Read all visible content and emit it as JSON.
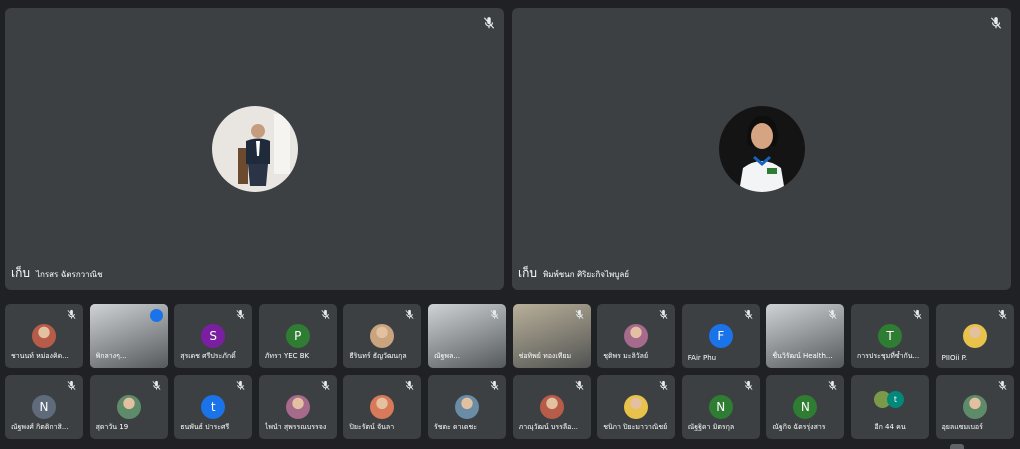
{
  "main_tiles": [
    {
      "name": "ไกรสร ฉัตรกวาณิช",
      "hide_label": "เก็บ",
      "muted": true
    },
    {
      "name": "พิมพ์ชนก ศิริยะกิจไพบูลย์",
      "hide_label": "เก็บ",
      "muted": true
    }
  ],
  "row1": [
    {
      "name": "ชานนท์ หม่องคิด...",
      "avatar": "photo",
      "muted": true
    },
    {
      "name": "พิกลางๆ...",
      "avatar": "video",
      "speaking": true
    },
    {
      "name": "สุรเดช ศรีประภักดิ์",
      "avatar": "letter",
      "letter": "S",
      "color": "#7b1fa2",
      "muted": true
    },
    {
      "name": "ภัทรา YEC BK",
      "avatar": "letter",
      "letter": "P",
      "color": "#2e7d32",
      "muted": true
    },
    {
      "name": "ธีรินทร์ ธัญวัฒนกุล",
      "avatar": "photo",
      "muted": true
    },
    {
      "name": "ณัฐพล...",
      "avatar": "video",
      "muted": true
    },
    {
      "name": "ช่อทิพย์ ทองเทียม",
      "avatar": "video",
      "muted": true
    },
    {
      "name": "ชุติพร มะลิวัลย์",
      "avatar": "photo",
      "muted": true
    },
    {
      "name": "FAir Phu",
      "avatar": "letter",
      "letter": "F",
      "color": "#1a73e8",
      "muted": true
    },
    {
      "name": "ชื่นวิรัฒน์ Health...",
      "avatar": "video",
      "muted": true
    },
    {
      "name": "การประชุมที่ซ้ำกัน...",
      "avatar": "letter",
      "letter": "T",
      "color": "#2e7d32",
      "muted": true
    },
    {
      "name": "PIIOii P.",
      "avatar": "photo",
      "muted": true
    }
  ],
  "row2": [
    {
      "name": "ณัฐพงศ์ กิตติกาสิ...",
      "avatar": "letter",
      "letter": "N",
      "color": "#5f6b7a",
      "muted": true
    },
    {
      "name": "สุดาวัน 19",
      "avatar": "photo",
      "muted": true
    },
    {
      "name": "ธนพันธ์ ปาระศรี",
      "avatar": "letter",
      "letter": "t",
      "color": "#1a73e8",
      "muted": true
    },
    {
      "name": "ไพนำ สุพรรณบรรจง",
      "avatar": "photo",
      "muted": true
    },
    {
      "name": "ปิยะรัตน์ จันลา",
      "avatar": "photo",
      "muted": true
    },
    {
      "name": "รัชตะ ดาเดชะ",
      "avatar": "photo",
      "muted": true
    },
    {
      "name": "ภาณุวัฒน์ บรรลือ...",
      "avatar": "photo",
      "muted": true
    },
    {
      "name": "ชนิกา ปิยะมาวาณิชย์",
      "avatar": "photo",
      "muted": true
    },
    {
      "name": "ณัฐฐิดา มิตรกุล",
      "avatar": "letter",
      "letter": "N",
      "color": "#2e7d32",
      "muted": true
    },
    {
      "name": "ณัฐกิจ ฉัตรรุ่งสาร",
      "avatar": "letter",
      "letter": "N",
      "color": "#2e7d32",
      "muted": true
    },
    {
      "name": "อีก 44 คน",
      "avatar": "more",
      "letter": "t",
      "muted": false
    },
    {
      "name": "อุยลแซมเบอร์",
      "avatar": "photo",
      "muted": true
    }
  ],
  "colors": {
    "background": "#202124",
    "tile": "#3c4043",
    "speaking": "#8ab4f8"
  },
  "icons": {
    "mic": "mic-off-icon",
    "speaking": "audio-level-icon"
  }
}
